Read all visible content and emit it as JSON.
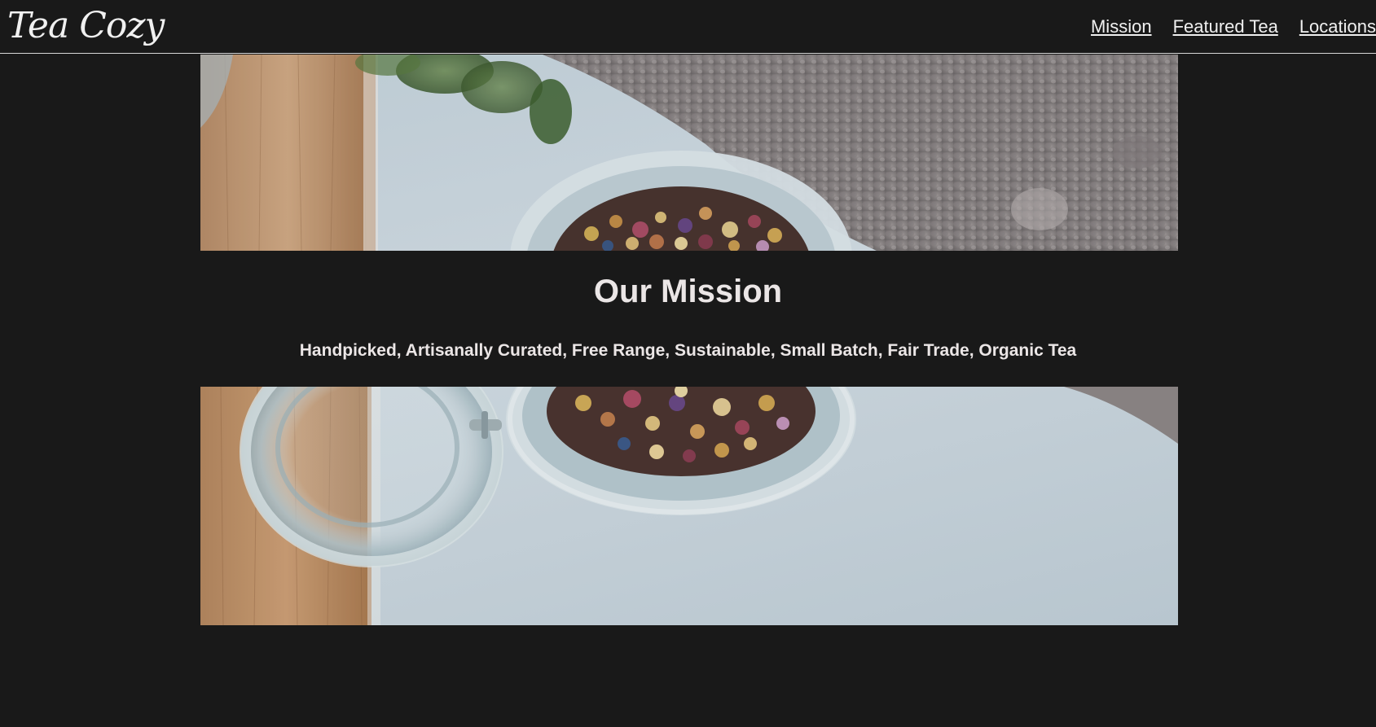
{
  "header": {
    "logo_text": "Tea Cozy",
    "nav": [
      {
        "label": "Mission"
      },
      {
        "label": "Featured Tea"
      },
      {
        "label": "Locations"
      }
    ]
  },
  "mission": {
    "title": "Our Mission",
    "subtitle": "Handpicked, Artisanally Curated, Free Range, Sustainable, Small Batch, Fair Trade, Organic Tea"
  },
  "colors": {
    "background": "#191919",
    "text": "#ebe6e6",
    "header_border": "#d8d8d8"
  }
}
